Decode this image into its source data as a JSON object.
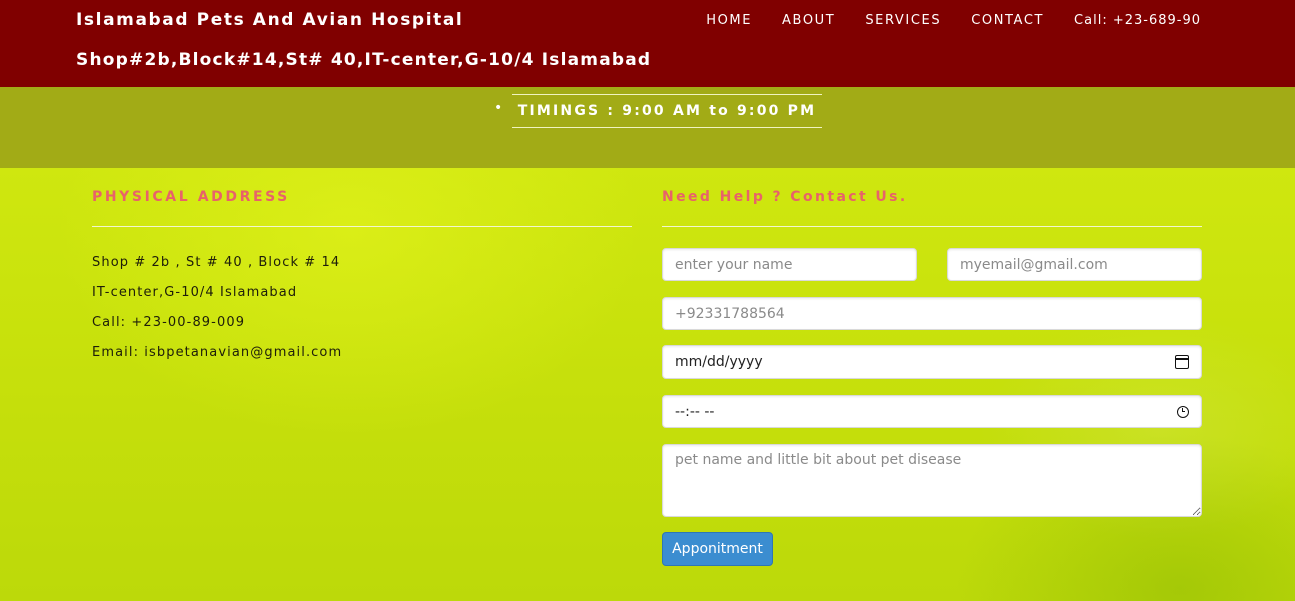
{
  "header": {
    "brand_name": "Islamabad Pets And Avian Hospital",
    "brand_address": "Shop#2b,Block#14,St# 40,IT-center,G-10/4 Islamabad",
    "nav": {
      "home": "HOME",
      "about": "ABOUT",
      "services": "SERVICES",
      "contact": "CONTACT",
      "call": "Call: +23-689-90"
    },
    "background_color": "#800000"
  },
  "timings": {
    "bullet": "•",
    "text": "TIMINGS : 9:00 AM to 9:00 PM",
    "background_color": "#a2ab16"
  },
  "physical_address": {
    "title": "PHYSICAL ADDRESS",
    "lines": [
      "Shop # 2b , St # 40 , Block # 14",
      "IT-center,G-10/4 Islamabad",
      "Call: +23-00-89-009",
      "Email: isbpetanavian@gmail.com"
    ]
  },
  "contact_form": {
    "title": "Need Help ? Contact Us.",
    "name_placeholder": "enter your name",
    "email_placeholder": "myemail@gmail.com",
    "phone_placeholder": "+92331788564",
    "date_value": "mm/dd/yyyy",
    "time_value": "--:-- --",
    "message_placeholder": "pet name and little bit about pet disease",
    "submit_label": "Apponitment",
    "title_color": "#e8626a",
    "button_color": "#3b8dd0"
  },
  "icons": {
    "date": "calendar-icon",
    "time": "clock-icon"
  }
}
